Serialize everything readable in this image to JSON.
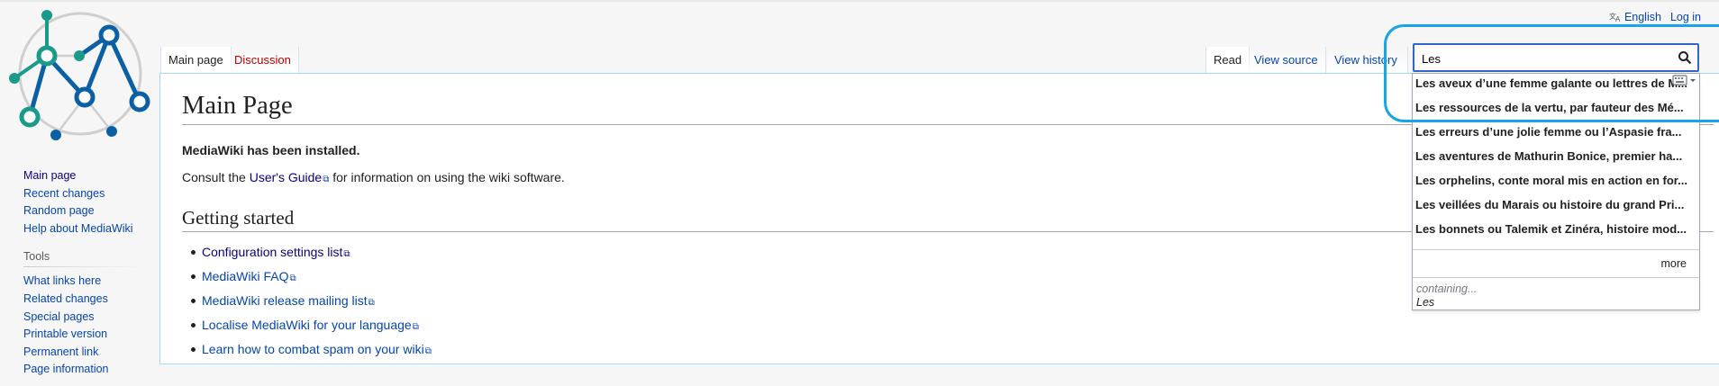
{
  "personal": {
    "language": "English",
    "login": "Log in"
  },
  "tabs": {
    "main_page": "Main page",
    "discussion": "Discussion",
    "read": "Read",
    "view_source": "View source",
    "view_history": "View history"
  },
  "sidebar": {
    "navigation": [
      "Main page",
      "Recent changes",
      "Random page",
      "Help about MediaWiki"
    ],
    "tools_heading": "Tools",
    "tools": [
      "What links here",
      "Related changes",
      "Special pages",
      "Printable version",
      "Permanent link",
      "Page information"
    ]
  },
  "content": {
    "title": "Main Page",
    "installed": "MediaWiki has been installed.",
    "consult_prefix": "Consult the ",
    "users_guide": "User's Guide",
    "consult_suffix": " for information on using the wiki software.",
    "getting_started": "Getting started",
    "links": [
      "Configuration settings list",
      "MediaWiki FAQ",
      "MediaWiki release mailing list",
      "Localise MediaWiki for your language",
      "Learn how to combat spam on your wiki"
    ]
  },
  "search": {
    "value": "Les",
    "suggestions": [
      "Les aveux d’une femme galante ou lettres de M...",
      "Les ressources de la vertu, par fauteur des Mé...",
      "Les erreurs d’une jolie femme ou l’Aspasie fra...",
      "Les aventures de Mathurin Bonice, premier ha...",
      "Les orphelins, conte moral mis en action en for...",
      "Les veillées du Marais ou histoire du grand Pri...",
      "Les bonnets ou Talemik et Zinéra, histoire mod..."
    ],
    "more": "more",
    "containing_label": "containing...",
    "containing_term": "Les"
  },
  "colors": {
    "link": "#0645ad",
    "visited": "#0b0080",
    "highlight": "#17a6e5",
    "logo_blue": "#0b5fa5",
    "logo_teal": "#1a9a8a"
  }
}
